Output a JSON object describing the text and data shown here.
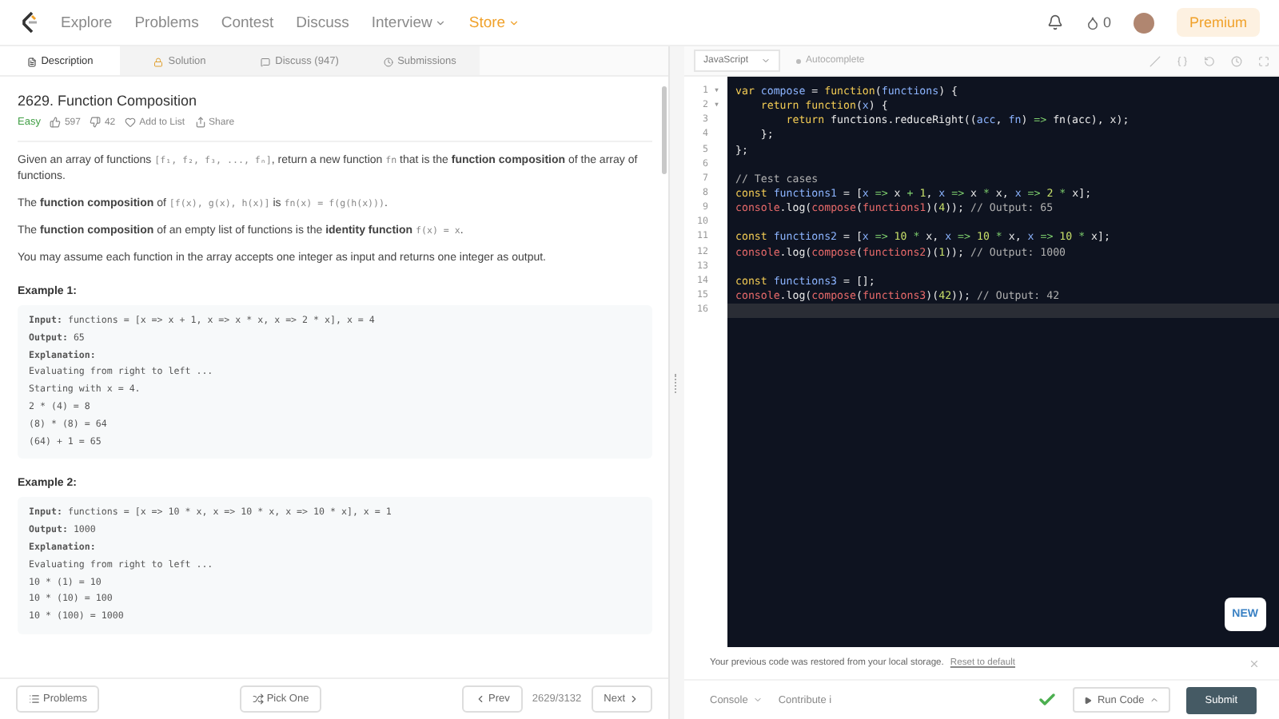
{
  "nav": {
    "links": [
      {
        "label": "Explore",
        "kind": "link"
      },
      {
        "label": "Problems",
        "kind": "link"
      },
      {
        "label": "Contest",
        "kind": "link"
      },
      {
        "label": "Discuss",
        "kind": "link"
      },
      {
        "label": "Interview",
        "kind": "menu"
      },
      {
        "label": "Store",
        "kind": "store"
      }
    ],
    "coins": "0",
    "premium": "Premium"
  },
  "tabs": [
    {
      "label": "Description",
      "selected": true
    },
    {
      "label": "Solution",
      "selected": false
    },
    {
      "label": "Discuss (947)",
      "selected": false
    },
    {
      "label": "Submissions",
      "selected": false
    }
  ],
  "problem": {
    "title": "2629. Function Composition",
    "difficulty": "Easy",
    "likes": "597",
    "dislikes": "42",
    "add_to_list": "Add to List",
    "share": "Share",
    "paragraphs": [
      [
        {
          "kind": "text",
          "text": "Given an array of functions "
        },
        {
          "kind": "code",
          "text": "[f₁, f₂, f₃, ..., fₙ]"
        },
        {
          "kind": "text",
          "text": ", return a new function "
        },
        {
          "kind": "code",
          "text": "fn"
        },
        {
          "kind": "text",
          "text": " that is the **function composition** of the array of functions."
        }
      ],
      [
        {
          "kind": "text",
          "text": "The **function composition** of "
        },
        {
          "kind": "code",
          "text": "[f(x), g(x), h(x)]"
        },
        {
          "kind": "text",
          "text": " is "
        },
        {
          "kind": "code",
          "text": "fn(x) = f(g(h(x)))"
        },
        {
          "kind": "text",
          "text": "."
        }
      ],
      [
        {
          "kind": "text",
          "text": "The **function composition** of an empty list of functions is the **identity function** "
        },
        {
          "kind": "code",
          "text": "f(x) = x"
        },
        {
          "kind": "text",
          "text": "."
        }
      ],
      [
        {
          "kind": "text",
          "text": "You may assume each function in the array accepts one integer as input and returns one integer as output."
        }
      ]
    ],
    "examples": [
      {
        "title": "Example 1:",
        "lines": [
          {
            "label": "Input:",
            "text": "functions = [x => x + 1, x => x * x, x => 2 * x], x = 4"
          },
          {
            "label": "Output:",
            "text": "65"
          },
          {
            "label": "Explanation:"
          },
          {
            "text": "Evaluating from right to left ..."
          },
          {
            "text": "Starting with x = 4."
          },
          {
            "text": "2 * (4) = 8"
          },
          {
            "text": "(8) * (8) = 64"
          },
          {
            "text": "(64) + 1 = 65"
          }
        ]
      },
      {
        "title": "Example 2:",
        "lines": [
          {
            "label": "Input:",
            "text": "functions = [x => 10 * x, x => 10 * x, x => 10 * x], x = 1"
          },
          {
            "label": "Output:",
            "text": "1000"
          },
          {
            "label": "Explanation:"
          },
          {
            "text": "Evaluating from right to left ..."
          },
          {
            "text": "10 * (1) = 10"
          },
          {
            "text": "10 * (10) = 100"
          },
          {
            "text": "10 * (100) = 1000"
          }
        ]
      }
    ]
  },
  "footer": {
    "problems": "Problems",
    "pick_one": "Pick One",
    "prev": "Prev",
    "counter": "2629/3132",
    "next": "Next"
  },
  "editor": {
    "language": "JavaScript",
    "autocomplete": "Autocomplete",
    "lines": [
      {
        "number": "1",
        "fold": "▾",
        "current": false,
        "tokens": [
          {
            "kind": "kw",
            "text": "var "
          },
          {
            "kind": "id",
            "text": "compose"
          },
          {
            "kind": "p",
            "text": " = "
          },
          {
            "kind": "kw",
            "text": "function"
          },
          {
            "kind": "p",
            "text": "("
          },
          {
            "kind": "id",
            "text": "functions"
          },
          {
            "kind": "p",
            "text": ") {"
          }
        ]
      },
      {
        "number": "2",
        "fold": "▾",
        "current": false,
        "tokens": [
          {
            "kind": "kw",
            "text": "    return function"
          },
          {
            "kind": "p",
            "text": "("
          },
          {
            "kind": "id",
            "text": "x"
          },
          {
            "kind": "p",
            "text": ") {"
          }
        ]
      },
      {
        "number": "3",
        "current": false,
        "tokens": [
          {
            "kind": "kw",
            "text": "        return "
          },
          {
            "kind": "p",
            "text": "functions.reduceRight(("
          },
          {
            "kind": "id",
            "text": "acc"
          },
          {
            "kind": "p",
            "text": ", "
          },
          {
            "kind": "id",
            "text": "fn"
          },
          {
            "kind": "p",
            "text": ") "
          },
          {
            "kind": "op",
            "text": "=>"
          },
          {
            "kind": "p",
            "text": " fn(acc), x);"
          }
        ]
      },
      {
        "number": "4",
        "current": false,
        "tokens": [
          {
            "kind": "p",
            "text": "    };"
          }
        ]
      },
      {
        "number": "5",
        "current": false,
        "tokens": [
          {
            "kind": "p",
            "text": "};"
          }
        ]
      },
      {
        "number": "6",
        "current": false
      },
      {
        "number": "7",
        "current": false,
        "tokens": [
          {
            "kind": "cm",
            "text": "// Test cases"
          }
        ]
      },
      {
        "number": "8",
        "current": false,
        "tokens": [
          {
            "kind": "kw",
            "text": "const "
          },
          {
            "kind": "id",
            "text": "functions1"
          },
          {
            "kind": "p",
            "text": " = ["
          },
          {
            "kind": "id",
            "text": "x"
          },
          {
            "kind": "op",
            "text": " => "
          },
          {
            "kind": "p",
            "text": "x "
          },
          {
            "kind": "op",
            "text": "+ "
          },
          {
            "kind": "num",
            "text": "1"
          },
          {
            "kind": "p",
            "text": ", "
          },
          {
            "kind": "id",
            "text": "x"
          },
          {
            "kind": "op",
            "text": " => "
          },
          {
            "kind": "p",
            "text": "x "
          },
          {
            "kind": "op",
            "text": "* "
          },
          {
            "kind": "p",
            "text": "x, "
          },
          {
            "kind": "id",
            "text": "x"
          },
          {
            "kind": "op",
            "text": " => "
          },
          {
            "kind": "num",
            "text": "2"
          },
          {
            "kind": "op",
            "text": " * "
          },
          {
            "kind": "p",
            "text": "x];"
          }
        ]
      },
      {
        "number": "9",
        "current": false,
        "tokens": [
          {
            "kind": "call",
            "text": "console"
          },
          {
            "kind": "p",
            "text": ".log("
          },
          {
            "kind": "call",
            "text": "compose"
          },
          {
            "kind": "p",
            "text": "("
          },
          {
            "kind": "call",
            "text": "functions1"
          },
          {
            "kind": "p",
            "text": ")("
          },
          {
            "kind": "num",
            "text": "4"
          },
          {
            "kind": "p",
            "text": ")); "
          },
          {
            "kind": "cm",
            "text": "// Output: 65"
          }
        ]
      },
      {
        "number": "10",
        "current": false
      },
      {
        "number": "11",
        "current": false,
        "tokens": [
          {
            "kind": "kw",
            "text": "const "
          },
          {
            "kind": "id",
            "text": "functions2"
          },
          {
            "kind": "p",
            "text": " = ["
          },
          {
            "kind": "id",
            "text": "x"
          },
          {
            "kind": "op",
            "text": " => "
          },
          {
            "kind": "num",
            "text": "10"
          },
          {
            "kind": "op",
            "text": " * "
          },
          {
            "kind": "p",
            "text": "x, "
          },
          {
            "kind": "id",
            "text": "x"
          },
          {
            "kind": "op",
            "text": " => "
          },
          {
            "kind": "num",
            "text": "10"
          },
          {
            "kind": "op",
            "text": " * "
          },
          {
            "kind": "p",
            "text": "x, "
          },
          {
            "kind": "id",
            "text": "x"
          },
          {
            "kind": "op",
            "text": " => "
          },
          {
            "kind": "num",
            "text": "10"
          },
          {
            "kind": "op",
            "text": " * "
          },
          {
            "kind": "p",
            "text": "x];"
          }
        ]
      },
      {
        "number": "12",
        "current": false,
        "tokens": [
          {
            "kind": "call",
            "text": "console"
          },
          {
            "kind": "p",
            "text": ".log("
          },
          {
            "kind": "call",
            "text": "compose"
          },
          {
            "kind": "p",
            "text": "("
          },
          {
            "kind": "call",
            "text": "functions2"
          },
          {
            "kind": "p",
            "text": ")("
          },
          {
            "kind": "num",
            "text": "1"
          },
          {
            "kind": "p",
            "text": ")); "
          },
          {
            "kind": "cm",
            "text": "// Output: 1000"
          }
        ]
      },
      {
        "number": "13",
        "current": false
      },
      {
        "number": "14",
        "current": false,
        "tokens": [
          {
            "kind": "kw",
            "text": "const "
          },
          {
            "kind": "id",
            "text": "functions3"
          },
          {
            "kind": "p",
            "text": " = [];"
          }
        ]
      },
      {
        "number": "15",
        "current": false,
        "tokens": [
          {
            "kind": "call",
            "text": "console"
          },
          {
            "kind": "p",
            "text": ".log("
          },
          {
            "kind": "call",
            "text": "compose"
          },
          {
            "kind": "p",
            "text": "("
          },
          {
            "kind": "call",
            "text": "functions3"
          },
          {
            "kind": "p",
            "text": ")("
          },
          {
            "kind": "num",
            "text": "42"
          },
          {
            "kind": "p",
            "text": ")); "
          },
          {
            "kind": "cm",
            "text": "// Output: 42"
          }
        ]
      },
      {
        "number": "16",
        "current": true
      }
    ],
    "new_badge": "NEW",
    "notice": "Your previous code was restored from your local storage.",
    "reset": "Reset to default",
    "console": "Console",
    "contribute": "Contribute",
    "contribute_icon": "i",
    "run": "Run Code",
    "submit": "Submit"
  }
}
